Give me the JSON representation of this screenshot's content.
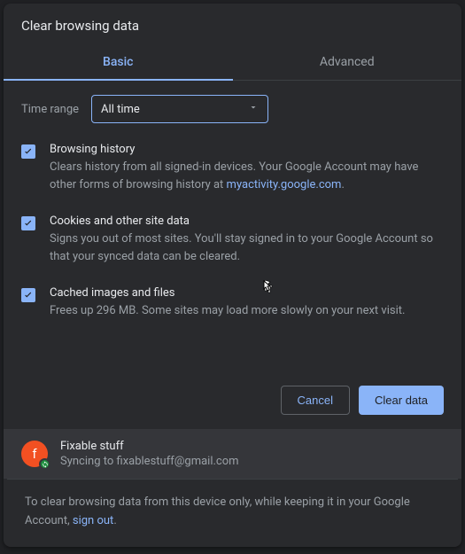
{
  "title": "Clear browsing data",
  "tabs": {
    "basic": "Basic",
    "advanced": "Advanced"
  },
  "timerange": {
    "label": "Time range",
    "value": "All time"
  },
  "options": [
    {
      "title": "Browsing history",
      "desc_pre": "Clears history from all signed-in devices. Your Google Account may have other forms of browsing history at ",
      "link": "myactivity.google.com",
      "desc_post": "."
    },
    {
      "title": "Cookies and other site data",
      "desc": "Signs you out of most sites. You'll stay signed in to your Google Account so that your synced data can be cleared."
    },
    {
      "title": "Cached images and files",
      "desc": "Frees up 296 MB. Some sites may load more slowly on your next visit."
    }
  ],
  "buttons": {
    "cancel": "Cancel",
    "clear": "Clear data"
  },
  "profile": {
    "initial": "f",
    "name": "Fixable stuff",
    "status": "Syncing to fixablestuff@gmail.com"
  },
  "footer": {
    "pre": "To clear browsing data from this device only, while keeping it in your Google Account, ",
    "link": "sign out",
    "post": "."
  }
}
